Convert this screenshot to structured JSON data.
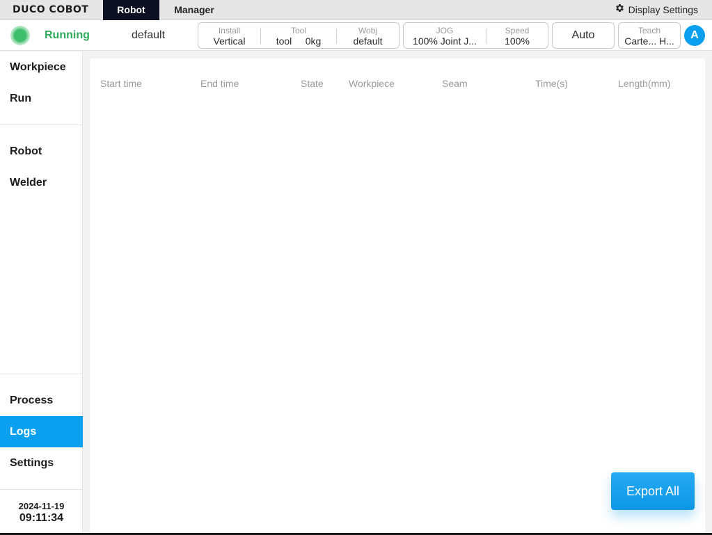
{
  "app": {
    "logo_text": "DUCO COBOT",
    "menu_tabs": [
      {
        "label": "Robot",
        "active": true
      },
      {
        "label": "Manager",
        "active": false
      }
    ],
    "display_settings_label": "Display Settings",
    "display_settings_icon": "gear-icon"
  },
  "status": {
    "state": "Running",
    "state_color": "#2eab5a",
    "program": "default",
    "install": {
      "caption": "Install",
      "value": "Vertical"
    },
    "tool": {
      "caption": "Tool",
      "name": "tool",
      "load": "0kg"
    },
    "wobj": {
      "caption": "Wobj",
      "value": "default"
    },
    "jog": {
      "caption": "JOG",
      "value": "100% Joint J..."
    },
    "speed": {
      "caption": "Speed",
      "value": "100%"
    },
    "mode": "Auto",
    "teach": {
      "caption": "Teach",
      "value": "Carte... H..."
    },
    "user_avatar": "A"
  },
  "sidebar": {
    "items": [
      {
        "label": "Workpiece"
      },
      {
        "label": "Run"
      },
      {
        "label": "Robot"
      },
      {
        "label": "Welder"
      },
      {
        "label": "Process"
      },
      {
        "label": "Logs",
        "active": true
      },
      {
        "label": "Settings"
      }
    ],
    "date": "2024-11-19",
    "time": "09:11:34"
  },
  "logs_table": {
    "columns": [
      "Start time",
      "End time",
      "State",
      "Workpiece",
      "Seam",
      "Time(s)",
      "Length(mm)"
    ],
    "rows": []
  },
  "actions": {
    "export_all": "Export All"
  },
  "colors": {
    "accent": "#0aa0ef",
    "active_tab_bg": "#0d0f22",
    "running_green": "#2eab5a"
  }
}
